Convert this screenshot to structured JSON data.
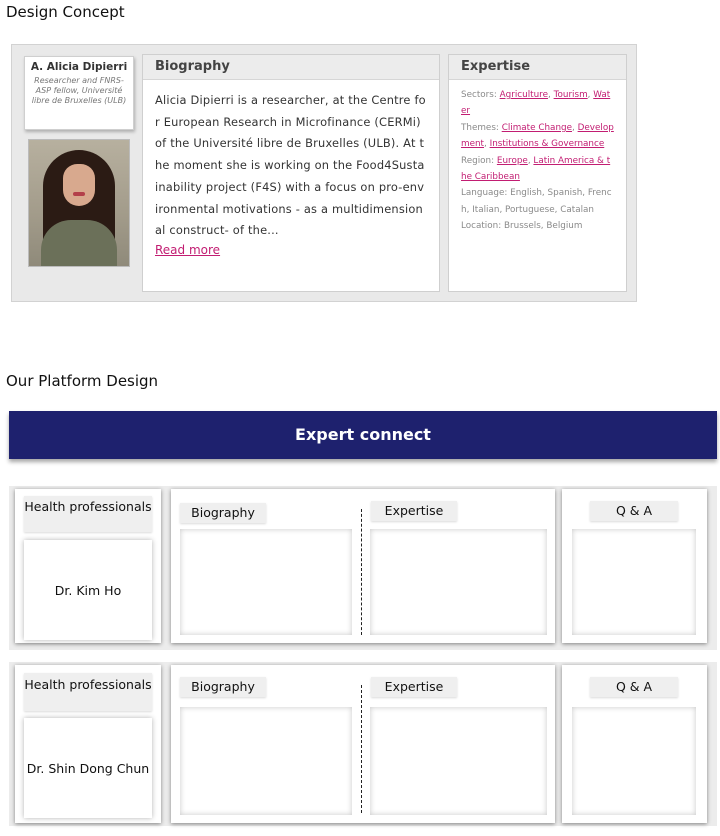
{
  "sections": {
    "concept_title": "Design Concept",
    "platform_title": "Our Platform Design"
  },
  "concept": {
    "name": "A. Alicia Dipierri",
    "affiliation": "Researcher and FNRS-ASP fellow, Université libre de Bruxelles (ULB)",
    "photo_icon": "portrait-photo",
    "biography": {
      "heading": "Biography",
      "text": "Alicia Dipierri is a researcher, at the Centre for European Research in Microfinance (CERMi) of the Université libre de Bruxelles (ULB). At the moment she is working on the Food4Sustainability project (F4S) with a focus on pro-environmental motivations - as a multidimensional construct- of the...",
      "read_more": "Read more"
    },
    "expertise": {
      "heading": "Expertise",
      "sectors_label": "Sectors:",
      "sectors": [
        "Agriculture",
        "Tourism",
        "Water"
      ],
      "themes_label": "Themes:",
      "themes": [
        "Climate Change",
        "Development",
        "Institutions & Governance"
      ],
      "region_label": "Region:",
      "regions": [
        "Europe",
        "Latin America & the Caribbean"
      ],
      "language": "Language: English, Spanish, French, Italian, Portuguese, Catalan",
      "location": "Location: Brussels, Belgium"
    }
  },
  "platform": {
    "banner": "Expert connect",
    "rows": [
      {
        "category": "Health professionals",
        "name": "Dr. Kim Ho",
        "biography_label": "Biography",
        "expertise_label": "Expertise",
        "qa_label": "Q & A"
      },
      {
        "category": "Health professionals",
        "name": "Dr. Shin Dong Chun",
        "biography_label": "Biography",
        "expertise_label": "Expertise",
        "qa_label": "Q & A"
      }
    ]
  },
  "colors": {
    "banner": "#1e216e",
    "link": "#c21d72"
  }
}
